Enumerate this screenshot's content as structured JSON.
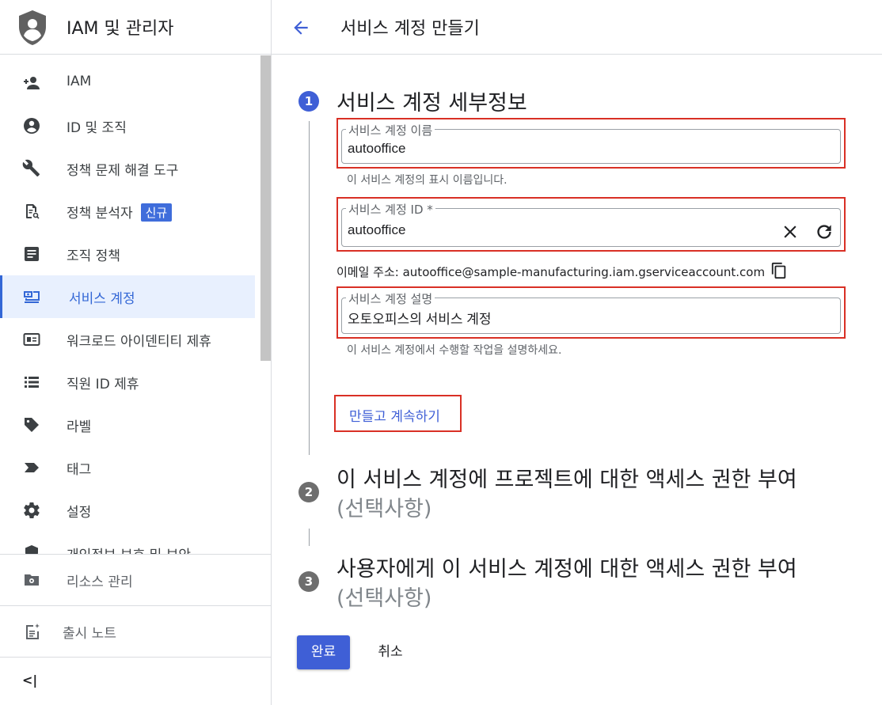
{
  "sidebar": {
    "title": "IAM 및 관리자",
    "items": [
      {
        "label": "IAM",
        "icon": "person-add-icon"
      },
      {
        "label": "ID 및 조직",
        "icon": "account-circle-icon"
      },
      {
        "label": "정책 문제 해결 도구",
        "icon": "wrench-icon"
      },
      {
        "label": "정책 분석자",
        "icon": "document-search-icon",
        "badge": "신규"
      },
      {
        "label": "조직 정책",
        "icon": "article-icon"
      },
      {
        "label": "서비스 계정",
        "icon": "service-account-icon",
        "active": true
      },
      {
        "label": "워크로드 아이덴티티 제휴",
        "icon": "id-card-icon"
      },
      {
        "label": "직원 ID 제휴",
        "icon": "list-icon"
      },
      {
        "label": "라벨",
        "icon": "tag-icon"
      },
      {
        "label": "태그",
        "icon": "label-arrow-icon"
      },
      {
        "label": "설정",
        "icon": "gear-icon"
      },
      {
        "label": "개인정보 보호 및 보안",
        "icon": "shield-icon"
      }
    ],
    "resource_manage": "리소스 관리",
    "release_notes": "출시 노트",
    "collapse": "<|"
  },
  "header": {
    "title": "서비스 계정 만들기"
  },
  "steps": {
    "step1": {
      "number": "1",
      "title": "서비스 계정 세부정보",
      "name_field": {
        "label": "서비스 계정 이름",
        "value": "autooffice",
        "hint": "이 서비스 계정의 표시 이름입니다."
      },
      "id_field": {
        "label": "서비스 계정 ID *",
        "value": "autooffice"
      },
      "email_label": "이메일 주소:",
      "email_value": "autooffice@sample-manufacturing.iam.gserviceaccount.com",
      "desc_field": {
        "label": "서비스 계정 설명",
        "value": "오토오피스의 서비스 계정",
        "hint": "이 서비스 계정에서 수행할 작업을 설명하세요."
      },
      "create_continue": "만들고 계속하기"
    },
    "step2": {
      "number": "2",
      "title": "이 서비스 계정에 프로젝트에 대한 액세스 권한 부여",
      "optional": "(선택사항)"
    },
    "step3": {
      "number": "3",
      "title": "사용자에게 이 서비스 계정에 대한 액세스 권한 부여",
      "optional": "(선택사항)"
    }
  },
  "actions": {
    "done": "완료",
    "cancel": "취소"
  },
  "colors": {
    "accent": "#3f5fd6",
    "highlight": "#d93025",
    "active_bg": "#e8f0fe"
  }
}
